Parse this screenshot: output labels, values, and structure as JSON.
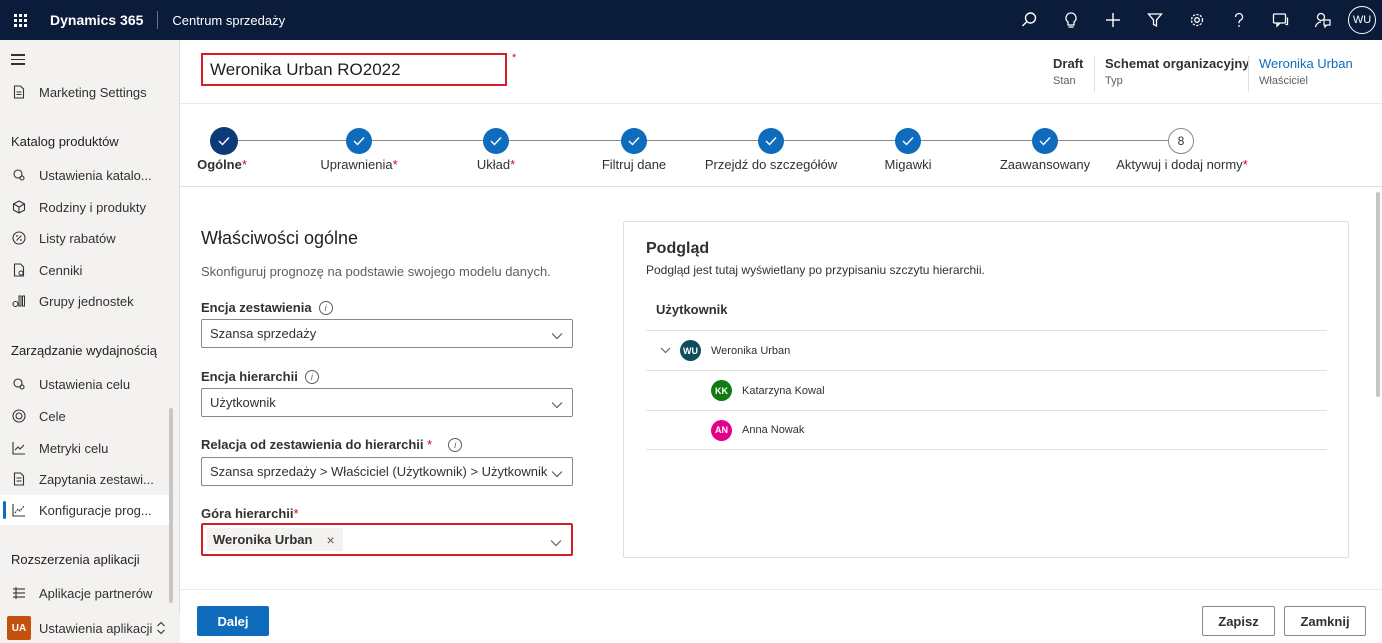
{
  "topbar": {
    "brand": "Dynamics 365",
    "app_name": "Centrum sprzedaży",
    "icons": [
      "search-icon",
      "lightbulb-icon",
      "plus-icon",
      "filter-icon",
      "settings-icon",
      "help-icon",
      "chat-icon",
      "person-feedback-icon"
    ],
    "user_initials": "WU"
  },
  "sidebar": {
    "items_top": [
      {
        "label": "Marketing Settings",
        "icon": "document-icon"
      }
    ],
    "group1": "Katalog produktów",
    "group1_items": [
      {
        "label": "Ustawienia katalo...",
        "icon": "catalog-settings-icon"
      },
      {
        "label": "Rodziny i produkty",
        "icon": "cube-icon"
      },
      {
        "label": "Listy rabatów",
        "icon": "discount-icon"
      },
      {
        "label": "Cenniki",
        "icon": "price-list-icon"
      },
      {
        "label": "Grupy jednostek",
        "icon": "units-icon"
      }
    ],
    "group2": "Zarządzanie wydajnością",
    "group2_items": [
      {
        "label": "Ustawienia celu",
        "icon": "goal-settings-icon"
      },
      {
        "label": "Cele",
        "icon": "target-icon"
      },
      {
        "label": "Metryki celu",
        "icon": "chart-line-icon"
      },
      {
        "label": "Zapytania zestawi...",
        "icon": "query-icon"
      },
      {
        "label": "Konfiguracje prog...",
        "icon": "forecast-icon"
      }
    ],
    "group3": "Rozszerzenia aplikacji",
    "group3_items": [
      {
        "label": "Aplikacje partnerów",
        "icon": "list-icon"
      }
    ],
    "area": {
      "badge": "UA",
      "label": "Ustawienia aplikacji"
    }
  },
  "header": {
    "title": "Weronika Urban RO2022",
    "required_mark": "*",
    "status_value": "Draft",
    "status_label": "Stan",
    "type_value": "Schemat organizacyjny",
    "type_label": "Typ",
    "owner_value": "Weronika Urban",
    "owner_label": "Właściciel"
  },
  "stepper": {
    "steps": [
      {
        "label": "Ogólne",
        "req": "*"
      },
      {
        "label": "Uprawnienia",
        "req": "*"
      },
      {
        "label": "Układ",
        "req": "*"
      },
      {
        "label": "Filtruj dane",
        "req": ""
      },
      {
        "label": "Przejdź do szczegółów",
        "req": ""
      },
      {
        "label": "Migawki",
        "req": ""
      },
      {
        "label": "Zaawansowany",
        "req": ""
      },
      {
        "label": "Aktywuj i dodaj normy",
        "req": "*"
      }
    ],
    "last_number": "8"
  },
  "form": {
    "title": "Właściwości ogólne",
    "description": "Skonfiguruj prognozę na podstawie swojego modelu danych.",
    "rollup_label": "Encja zestawienia",
    "rollup_value": "Szansa sprzedaży",
    "hierarchy_label": "Encja hierarchii",
    "hierarchy_value": "Użytkownik",
    "relation_label": "Relacja od zestawienia do hierarchii",
    "relation_req": "*",
    "relation_value": "Szansa sprzedaży > Właściciel (Użytkownik) > Użytkownik",
    "top_label": "Góra hierarchii",
    "top_req": "*",
    "top_value": "Weronika Urban",
    "info_glyph": "i",
    "remove_glyph": "×"
  },
  "preview": {
    "title": "Podgląd",
    "description": "Podgląd jest tutaj wyświetlany po przypisaniu szczytu hierarchii.",
    "column_header": "Użytkownik",
    "rows": [
      {
        "initials": "WU",
        "name": "Weronika Urban",
        "color": "#0f4c5c"
      },
      {
        "initials": "KK",
        "name": "Katarzyna Kowal",
        "color": "#107c10"
      },
      {
        "initials": "AN",
        "name": "Anna Nowak",
        "color": "#e3008c"
      }
    ]
  },
  "footer": {
    "next_label": "Dalej",
    "save_label": "Zapisz",
    "close_label": "Zamknij"
  },
  "colors": {
    "topbar": "#0b1b3a",
    "accent": "#0f6cbd",
    "highlight_border": "#d11f2a"
  }
}
